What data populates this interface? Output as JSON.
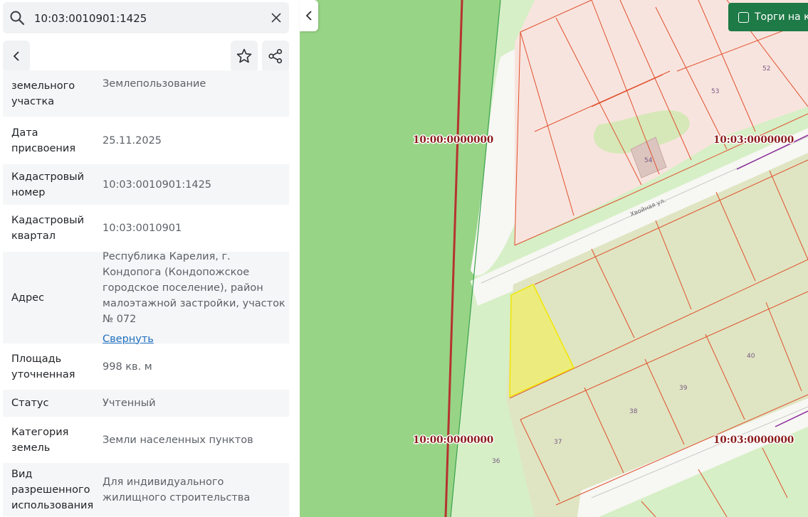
{
  "search": {
    "value": "10:03:0010901:1425"
  },
  "icons": {
    "search": "search-icon",
    "clear": "close-icon",
    "back": "chevron-left-icon",
    "favorite": "star-icon",
    "share": "share-icon",
    "collapse": "chevron-left-icon"
  },
  "details": {
    "rows": [
      {
        "key": "земельного участка",
        "value": "Землепользование"
      },
      {
        "key": "Дата присвоения",
        "value": "25.11.2025"
      },
      {
        "key": "Кадастровый номер",
        "value": "10:03:0010901:1425"
      },
      {
        "key": "Кадастровый квартал",
        "value": "10:03:0010901"
      },
      {
        "key": "Адрес",
        "value": "Республика Карелия, г. Кондопога (Кондопожское городское поселение), район малоэтажной застройки, участок № 072",
        "link": "Свернуть"
      },
      {
        "key": "Площадь уточненная",
        "value": "998 кв. м"
      },
      {
        "key": "Статус",
        "value": "Учтенный"
      },
      {
        "key": "Категория земель",
        "value": "Земли населенных пунктов"
      },
      {
        "key": "Вид разрешенного использования",
        "value": "Для индивидуального жилищного строительства"
      }
    ]
  },
  "map": {
    "auction_label": "Торги на к",
    "quarters": [
      "10:00:0000000",
      "10:03:0000000",
      "10:00:0000000",
      "10:03:0000000"
    ],
    "street": "Хвойная ул.",
    "plots": [
      "52",
      "53",
      "54",
      "40",
      "39",
      "38",
      "37",
      "36"
    ],
    "colors": {
      "forest": "#97d486",
      "meadow": "#d6efc6",
      "plot_fill": "#dfe5c2",
      "residential": "#f8e4de",
      "road": "#f7f7f3",
      "boundary": "#e0502d",
      "selected": "#ecec7e",
      "selected_border": "#f2e600",
      "quarter_line": "#b5332f",
      "accent": "#1e7a46"
    }
  }
}
